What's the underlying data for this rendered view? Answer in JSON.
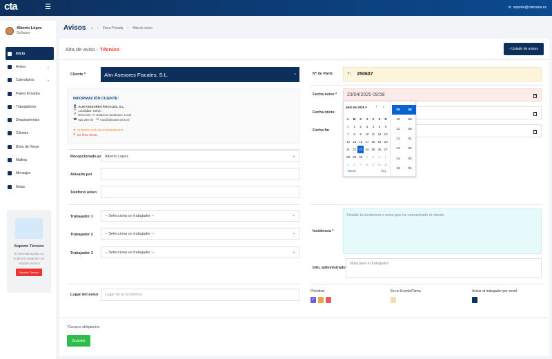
{
  "topbar": {
    "logo": "cta",
    "email": "soporte@ctalcasar.es"
  },
  "user": {
    "name": "Alberto López",
    "role": "Software"
  },
  "nav": [
    {
      "label": "Inicio",
      "active": true,
      "icon": "home-icon"
    },
    {
      "label": "Avisos",
      "icon": "bell-icon",
      "caret": true
    },
    {
      "label": "Calendarios",
      "icon": "calendar-icon",
      "caret": true
    },
    {
      "label": "Partes firmados",
      "icon": "file-signature-icon"
    },
    {
      "label": "Trabajadores",
      "icon": "id-card-icon"
    },
    {
      "label": "Departamentos",
      "icon": "building-icon"
    },
    {
      "label": "Clientes",
      "icon": "users-icon"
    },
    {
      "label": "Bono de Horas",
      "icon": "clock-icon"
    },
    {
      "label": "Mailing",
      "icon": "envelope-icon"
    },
    {
      "label": "Mensajes",
      "icon": "chat-icon"
    },
    {
      "label": "Notas",
      "icon": "note-icon"
    }
  ],
  "support": {
    "title": "Soporte Técnico",
    "text": "Si necesita ayuda, no dude en contactar con soporte técnico",
    "button": "Soporte Técnico"
  },
  "page": {
    "title": "Avisos",
    "breadcrumb": [
      "Zona Privada",
      "Alta de aviso"
    ]
  },
  "card": {
    "title_prefix": "Alta de aviso - ",
    "title_accent": "Técnico",
    "list_button": "Listado de avisos"
  },
  "form": {
    "cliente_label": "Cliente *",
    "cliente_value": "Alm Asesores Fiscales, S.L.",
    "info": {
      "title": "INFORMACIÓN CLIENTE:",
      "name": "ALM ASESORES FISCALES, S.L.",
      "localidad": "Localidad: Toledo",
      "direccion": "Dirección: Tr. Estacion Autobuses, Local",
      "phone": "925 280 00 -",
      "email": "mas@almasesores.es",
      "mantenimiento": "CLIENTE CON MANTENIMIENTO",
      "ver_ficha": "Ver ficha cliente"
    },
    "recepcionado_label": "Recepcionado por",
    "recepcionado_value": "Alberto López",
    "avisado_label": "Avisado por",
    "telefono_label": "Teléfono aviso",
    "trabajador1_label": "Trabajador 1",
    "trabajador2_label": "Trabajador 2",
    "trabajador3_label": "Trabajador 3",
    "trabajador_placeholder": "-- Selecciona un trabajador --",
    "lugar_label": "Lugar del aviso",
    "lugar_placeholder": "Lugar de la incidencia",
    "parte_label": "Nº de Parte",
    "parte_prefix": "T-",
    "parte_value": "250607",
    "fecha_aviso_label": "Fecha aviso *",
    "fecha_aviso_value": "23/04/2025 09:58",
    "fecha_inicio_label": "Fecha inicio",
    "fecha_fin_label": "Fecha fin",
    "incidencia_label": "Incidencia *",
    "incidencia_placeholder": "Detalle la incidencia o aviso que ha comunicado el cliente",
    "info_admin_label": "Info. administrador",
    "info_admin_placeholder": "Nota para el trabajador",
    "prioridad_label": "Prioridad",
    "evento_label": "Es un Evento/Tarea",
    "avisar_label": "Avisar al trabajador por email",
    "required_note": "*Campos obligatorios",
    "save": "Guardar"
  },
  "datepicker": {
    "month": "abril de 2025",
    "weekdays": [
      "L",
      "M",
      "X",
      "J",
      "V",
      "S",
      "D"
    ],
    "weeks": [
      [
        "31",
        "1",
        "2",
        "3",
        "4",
        "5",
        "6"
      ],
      [
        "7",
        "8",
        "9",
        "10",
        "11",
        "12",
        "13"
      ],
      [
        "14",
        "15",
        "16",
        "17",
        "18",
        "19",
        "20"
      ],
      [
        "21",
        "22",
        "23",
        "24",
        "25",
        "26",
        "27"
      ],
      [
        "28",
        "29",
        "30",
        "1",
        "2",
        "3",
        "4"
      ],
      [
        "5",
        "6",
        "7",
        "8",
        "9",
        "10",
        "11"
      ]
    ],
    "selected": "23",
    "clear": "Borrar",
    "today": "Hoy",
    "hours": [
      "09",
      "10",
      "11",
      "12",
      "13",
      "14",
      "15"
    ],
    "minutes": [
      "58",
      "59",
      "00",
      "01",
      "02",
      "03",
      "04"
    ]
  },
  "colors": {
    "navy": "#0d2f5c",
    "red": "#e33333",
    "green": "#2ebd4a",
    "prio_low": "#6e5bd8",
    "prio_mid": "#f4a24a",
    "prio_high": "#e95b5b",
    "evento": "#f1e1b0"
  }
}
